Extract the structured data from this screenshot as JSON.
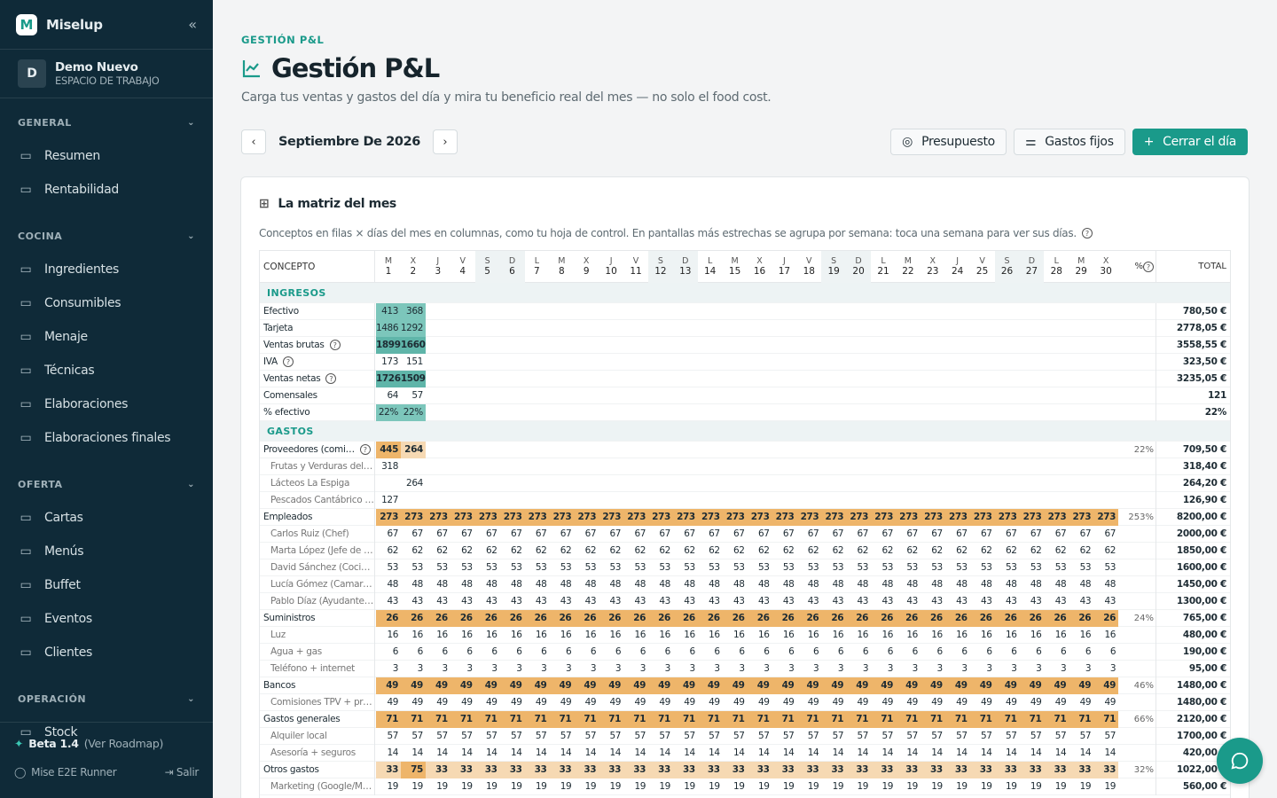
{
  "app": {
    "name": "Miselup"
  },
  "workspace": {
    "name": "Demo Nuevo",
    "subtitle": "ESPACIO DE TRABAJO",
    "initial": "D"
  },
  "sidebar": {
    "sections": [
      {
        "title": "GENERAL",
        "items": [
          {
            "label": "Resumen",
            "icon": "grid-icon"
          },
          {
            "label": "Rentabilidad",
            "icon": "bar-chart-icon"
          }
        ]
      },
      {
        "title": "COCINA",
        "items": [
          {
            "label": "Ingredientes",
            "icon": "carrot-icon"
          },
          {
            "label": "Consumibles",
            "icon": "box-icon"
          },
          {
            "label": "Menaje",
            "icon": "utensil-icon"
          },
          {
            "label": "Técnicas",
            "icon": "graduation-icon"
          },
          {
            "label": "Elaboraciones",
            "icon": "pot-icon"
          },
          {
            "label": "Elaboraciones finales",
            "icon": "cutlery-icon"
          }
        ]
      },
      {
        "title": "OFERTA",
        "items": [
          {
            "label": "Cartas",
            "icon": "book-icon"
          },
          {
            "label": "Menús",
            "icon": "clipboard-icon"
          },
          {
            "label": "Buffet",
            "icon": "cloche-icon"
          },
          {
            "label": "Eventos",
            "icon": "party-icon"
          },
          {
            "label": "Clientes",
            "icon": "contact-icon"
          }
        ]
      },
      {
        "title": "OPERACIÓN",
        "items": [
          {
            "label": "Stock",
            "icon": "boxes-icon"
          }
        ]
      }
    ],
    "footer": {
      "beta": "Beta 1.4",
      "roadmap": "(Ver Roadmap)",
      "user": "Mise E2E Runner",
      "logout": "Salir"
    }
  },
  "header": {
    "kicker": "GESTIÓN P&L",
    "title": "Gestión P&L",
    "subtitle": "Carga tus ventas y gastos del día y mira tu beneficio real del mes — no solo el food cost."
  },
  "toolbar": {
    "month": "Septiembre De 2026",
    "budget": "Presupuesto",
    "fixed": "Gastos fijos",
    "close_day": "Cerrar el día"
  },
  "matrix": {
    "title": "La matriz del mes",
    "description": "Conceptos en filas × días del mes en columnas, como tu hoja de control. En pantallas más estrechas se agrupa por semana: toca una semana para ver sus días.",
    "concept_header": "CONCEPTO",
    "pct_header": "%",
    "total_header": "TOTAL",
    "days": [
      [
        "M",
        "1"
      ],
      [
        "X",
        "2"
      ],
      [
        "J",
        "3"
      ],
      [
        "V",
        "4"
      ],
      [
        "S",
        "5"
      ],
      [
        "D",
        "6"
      ],
      [
        "L",
        "7"
      ],
      [
        "M",
        "8"
      ],
      [
        "X",
        "9"
      ],
      [
        "J",
        "10"
      ],
      [
        "V",
        "11"
      ],
      [
        "S",
        "12"
      ],
      [
        "D",
        "13"
      ],
      [
        "L",
        "14"
      ],
      [
        "M",
        "15"
      ],
      [
        "X",
        "16"
      ],
      [
        "J",
        "17"
      ],
      [
        "V",
        "18"
      ],
      [
        "S",
        "19"
      ],
      [
        "D",
        "20"
      ],
      [
        "L",
        "21"
      ],
      [
        "M",
        "22"
      ],
      [
        "X",
        "23"
      ],
      [
        "J",
        "24"
      ],
      [
        "V",
        "25"
      ],
      [
        "S",
        "26"
      ],
      [
        "D",
        "27"
      ],
      [
        "L",
        "28"
      ],
      [
        "M",
        "29"
      ],
      [
        "X",
        "30"
      ]
    ],
    "rows": [
      {
        "kind": "section",
        "label": "INGRESOS"
      },
      {
        "label": "Efectivo",
        "values": [
          "413",
          "368"
        ],
        "total": "780,50 €",
        "style": "teal"
      },
      {
        "label": "Tarjeta",
        "values": [
          "1486",
          "1292"
        ],
        "total": "2778,05 €",
        "style": "teal"
      },
      {
        "label": "Ventas brutas",
        "help": true,
        "values": [
          "1899",
          "1660"
        ],
        "total": "3558,55 €",
        "style": "teal-bold"
      },
      {
        "label": "IVA",
        "help": true,
        "values": [
          "173",
          "151"
        ],
        "total": "323,50 €",
        "style": "plain"
      },
      {
        "label": "Ventas netas",
        "help": true,
        "values": [
          "1726",
          "1509"
        ],
        "total": "3235,05 €",
        "style": "teal-bold"
      },
      {
        "label": "Comensales",
        "values": [
          "64",
          "57"
        ],
        "total": "121",
        "style": "plain"
      },
      {
        "label": "% efectivo",
        "values": [
          "22%",
          "22%"
        ],
        "total": "22%",
        "style": "teal"
      },
      {
        "kind": "section",
        "label": "GASTOS"
      },
      {
        "label": "Proveedores (comi…",
        "help": true,
        "values": [
          "445",
          "264"
        ],
        "pct": "22%",
        "total": "709,50 €",
        "style": "orange-mixed"
      },
      {
        "label": "Frutas y Verduras del L…",
        "sub": true,
        "values": [
          "318"
        ],
        "total": "318,40 €",
        "style": "plain"
      },
      {
        "label": "Lácteos La Espiga",
        "sub": true,
        "values": [
          "",
          "264"
        ],
        "total": "264,20 €",
        "style": "plain"
      },
      {
        "label": "Pescados Cantábrico …",
        "sub": true,
        "values": [
          "127"
        ],
        "total": "126,90 €",
        "style": "plain"
      },
      {
        "label": "Empleados",
        "fill": "273",
        "pct": "253%",
        "total": "8200,00 €",
        "style": "orange"
      },
      {
        "label": "Carlos Ruiz (Chef)",
        "sub": true,
        "fill": "67",
        "total": "2000,00 €",
        "style": "plain"
      },
      {
        "label": "Marta López (Jefe de s…",
        "sub": true,
        "fill": "62",
        "total": "1850,00 €",
        "style": "plain"
      },
      {
        "label": "David Sánchez (Cocin…",
        "sub": true,
        "fill": "53",
        "total": "1600,00 €",
        "style": "plain"
      },
      {
        "label": "Lucía Gómez (Camare…",
        "sub": true,
        "fill": "48",
        "total": "1450,00 €",
        "style": "plain"
      },
      {
        "label": "Pablo Díaz (Ayudante …",
        "sub": true,
        "fill": "43",
        "total": "1300,00 €",
        "style": "plain"
      },
      {
        "label": "Suministros",
        "fill": "26",
        "pct": "24%",
        "total": "765,00 €",
        "style": "orange"
      },
      {
        "label": "Luz",
        "sub": true,
        "fill": "16",
        "total": "480,00 €",
        "style": "plain"
      },
      {
        "label": "Agua + gas",
        "sub": true,
        "fill": "6",
        "total": "190,00 €",
        "style": "plain"
      },
      {
        "label": "Teléfono + internet",
        "sub": true,
        "fill": "3",
        "total": "95,00 €",
        "style": "plain"
      },
      {
        "label": "Bancos",
        "fill": "49",
        "pct": "46%",
        "total": "1480,00 €",
        "style": "orange"
      },
      {
        "label": "Comisiones TPV + pré…",
        "sub": true,
        "fill": "49",
        "total": "1480,00 €",
        "style": "plain"
      },
      {
        "label": "Gastos generales",
        "fill": "71",
        "pct": "66%",
        "total": "2120,00 €",
        "style": "orange"
      },
      {
        "label": "Alquiler local",
        "sub": true,
        "fill": "57",
        "total": "1700,00 €",
        "style": "plain"
      },
      {
        "label": "Asesoría + seguros",
        "sub": true,
        "fill": "14",
        "total": "420,00 €",
        "style": "plain"
      },
      {
        "label": "Otros gastos",
        "fill": "33",
        "override": {
          "1": "75"
        },
        "pct": "32%",
        "total": "1022,00 €",
        "style": "peach"
      },
      {
        "label": "Marketing (Google/M…",
        "sub": true,
        "fill": "19",
        "total": "560,00 €",
        "style": "plain"
      }
    ]
  },
  "colors": {
    "accent": "#1a9a8a",
    "sidebar": "#0f2a38",
    "teal_cell": "#7cc6bb",
    "teal_strong": "#5fb5a9",
    "orange": "#eeb56a",
    "peach": "#f6d9b3"
  }
}
